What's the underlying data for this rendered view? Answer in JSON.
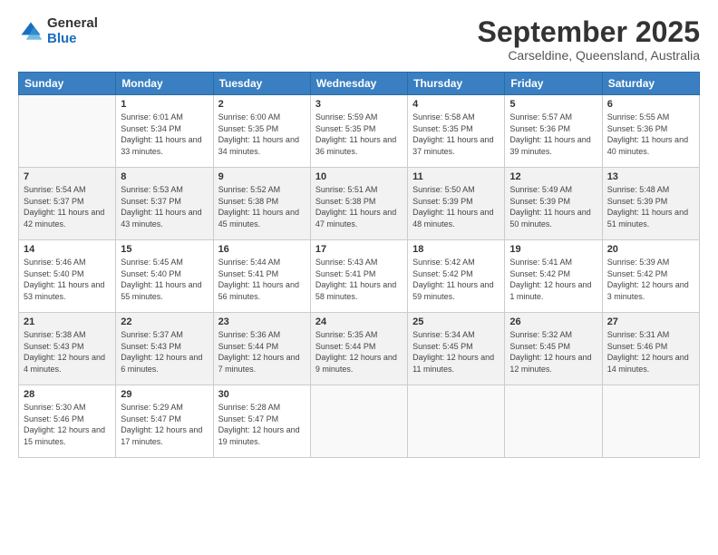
{
  "logo": {
    "general": "General",
    "blue": "Blue"
  },
  "header": {
    "month": "September 2025",
    "location": "Carseldine, Queensland, Australia"
  },
  "weekdays": [
    "Sunday",
    "Monday",
    "Tuesday",
    "Wednesday",
    "Thursday",
    "Friday",
    "Saturday"
  ],
  "weeks": [
    [
      {
        "day": "",
        "sunrise": "",
        "sunset": "",
        "daylight": ""
      },
      {
        "day": "1",
        "sunrise": "Sunrise: 6:01 AM",
        "sunset": "Sunset: 5:34 PM",
        "daylight": "Daylight: 11 hours and 33 minutes."
      },
      {
        "day": "2",
        "sunrise": "Sunrise: 6:00 AM",
        "sunset": "Sunset: 5:35 PM",
        "daylight": "Daylight: 11 hours and 34 minutes."
      },
      {
        "day": "3",
        "sunrise": "Sunrise: 5:59 AM",
        "sunset": "Sunset: 5:35 PM",
        "daylight": "Daylight: 11 hours and 36 minutes."
      },
      {
        "day": "4",
        "sunrise": "Sunrise: 5:58 AM",
        "sunset": "Sunset: 5:35 PM",
        "daylight": "Daylight: 11 hours and 37 minutes."
      },
      {
        "day": "5",
        "sunrise": "Sunrise: 5:57 AM",
        "sunset": "Sunset: 5:36 PM",
        "daylight": "Daylight: 11 hours and 39 minutes."
      },
      {
        "day": "6",
        "sunrise": "Sunrise: 5:55 AM",
        "sunset": "Sunset: 5:36 PM",
        "daylight": "Daylight: 11 hours and 40 minutes."
      }
    ],
    [
      {
        "day": "7",
        "sunrise": "Sunrise: 5:54 AM",
        "sunset": "Sunset: 5:37 PM",
        "daylight": "Daylight: 11 hours and 42 minutes."
      },
      {
        "day": "8",
        "sunrise": "Sunrise: 5:53 AM",
        "sunset": "Sunset: 5:37 PM",
        "daylight": "Daylight: 11 hours and 43 minutes."
      },
      {
        "day": "9",
        "sunrise": "Sunrise: 5:52 AM",
        "sunset": "Sunset: 5:38 PM",
        "daylight": "Daylight: 11 hours and 45 minutes."
      },
      {
        "day": "10",
        "sunrise": "Sunrise: 5:51 AM",
        "sunset": "Sunset: 5:38 PM",
        "daylight": "Daylight: 11 hours and 47 minutes."
      },
      {
        "day": "11",
        "sunrise": "Sunrise: 5:50 AM",
        "sunset": "Sunset: 5:39 PM",
        "daylight": "Daylight: 11 hours and 48 minutes."
      },
      {
        "day": "12",
        "sunrise": "Sunrise: 5:49 AM",
        "sunset": "Sunset: 5:39 PM",
        "daylight": "Daylight: 11 hours and 50 minutes."
      },
      {
        "day": "13",
        "sunrise": "Sunrise: 5:48 AM",
        "sunset": "Sunset: 5:39 PM",
        "daylight": "Daylight: 11 hours and 51 minutes."
      }
    ],
    [
      {
        "day": "14",
        "sunrise": "Sunrise: 5:46 AM",
        "sunset": "Sunset: 5:40 PM",
        "daylight": "Daylight: 11 hours and 53 minutes."
      },
      {
        "day": "15",
        "sunrise": "Sunrise: 5:45 AM",
        "sunset": "Sunset: 5:40 PM",
        "daylight": "Daylight: 11 hours and 55 minutes."
      },
      {
        "day": "16",
        "sunrise": "Sunrise: 5:44 AM",
        "sunset": "Sunset: 5:41 PM",
        "daylight": "Daylight: 11 hours and 56 minutes."
      },
      {
        "day": "17",
        "sunrise": "Sunrise: 5:43 AM",
        "sunset": "Sunset: 5:41 PM",
        "daylight": "Daylight: 11 hours and 58 minutes."
      },
      {
        "day": "18",
        "sunrise": "Sunrise: 5:42 AM",
        "sunset": "Sunset: 5:42 PM",
        "daylight": "Daylight: 11 hours and 59 minutes."
      },
      {
        "day": "19",
        "sunrise": "Sunrise: 5:41 AM",
        "sunset": "Sunset: 5:42 PM",
        "daylight": "Daylight: 12 hours and 1 minute."
      },
      {
        "day": "20",
        "sunrise": "Sunrise: 5:39 AM",
        "sunset": "Sunset: 5:42 PM",
        "daylight": "Daylight: 12 hours and 3 minutes."
      }
    ],
    [
      {
        "day": "21",
        "sunrise": "Sunrise: 5:38 AM",
        "sunset": "Sunset: 5:43 PM",
        "daylight": "Daylight: 12 hours and 4 minutes."
      },
      {
        "day": "22",
        "sunrise": "Sunrise: 5:37 AM",
        "sunset": "Sunset: 5:43 PM",
        "daylight": "Daylight: 12 hours and 6 minutes."
      },
      {
        "day": "23",
        "sunrise": "Sunrise: 5:36 AM",
        "sunset": "Sunset: 5:44 PM",
        "daylight": "Daylight: 12 hours and 7 minutes."
      },
      {
        "day": "24",
        "sunrise": "Sunrise: 5:35 AM",
        "sunset": "Sunset: 5:44 PM",
        "daylight": "Daylight: 12 hours and 9 minutes."
      },
      {
        "day": "25",
        "sunrise": "Sunrise: 5:34 AM",
        "sunset": "Sunset: 5:45 PM",
        "daylight": "Daylight: 12 hours and 11 minutes."
      },
      {
        "day": "26",
        "sunrise": "Sunrise: 5:32 AM",
        "sunset": "Sunset: 5:45 PM",
        "daylight": "Daylight: 12 hours and 12 minutes."
      },
      {
        "day": "27",
        "sunrise": "Sunrise: 5:31 AM",
        "sunset": "Sunset: 5:46 PM",
        "daylight": "Daylight: 12 hours and 14 minutes."
      }
    ],
    [
      {
        "day": "28",
        "sunrise": "Sunrise: 5:30 AM",
        "sunset": "Sunset: 5:46 PM",
        "daylight": "Daylight: 12 hours and 15 minutes."
      },
      {
        "day": "29",
        "sunrise": "Sunrise: 5:29 AM",
        "sunset": "Sunset: 5:47 PM",
        "daylight": "Daylight: 12 hours and 17 minutes."
      },
      {
        "day": "30",
        "sunrise": "Sunrise: 5:28 AM",
        "sunset": "Sunset: 5:47 PM",
        "daylight": "Daylight: 12 hours and 19 minutes."
      },
      {
        "day": "",
        "sunrise": "",
        "sunset": "",
        "daylight": ""
      },
      {
        "day": "",
        "sunrise": "",
        "sunset": "",
        "daylight": ""
      },
      {
        "day": "",
        "sunrise": "",
        "sunset": "",
        "daylight": ""
      },
      {
        "day": "",
        "sunrise": "",
        "sunset": "",
        "daylight": ""
      }
    ]
  ]
}
